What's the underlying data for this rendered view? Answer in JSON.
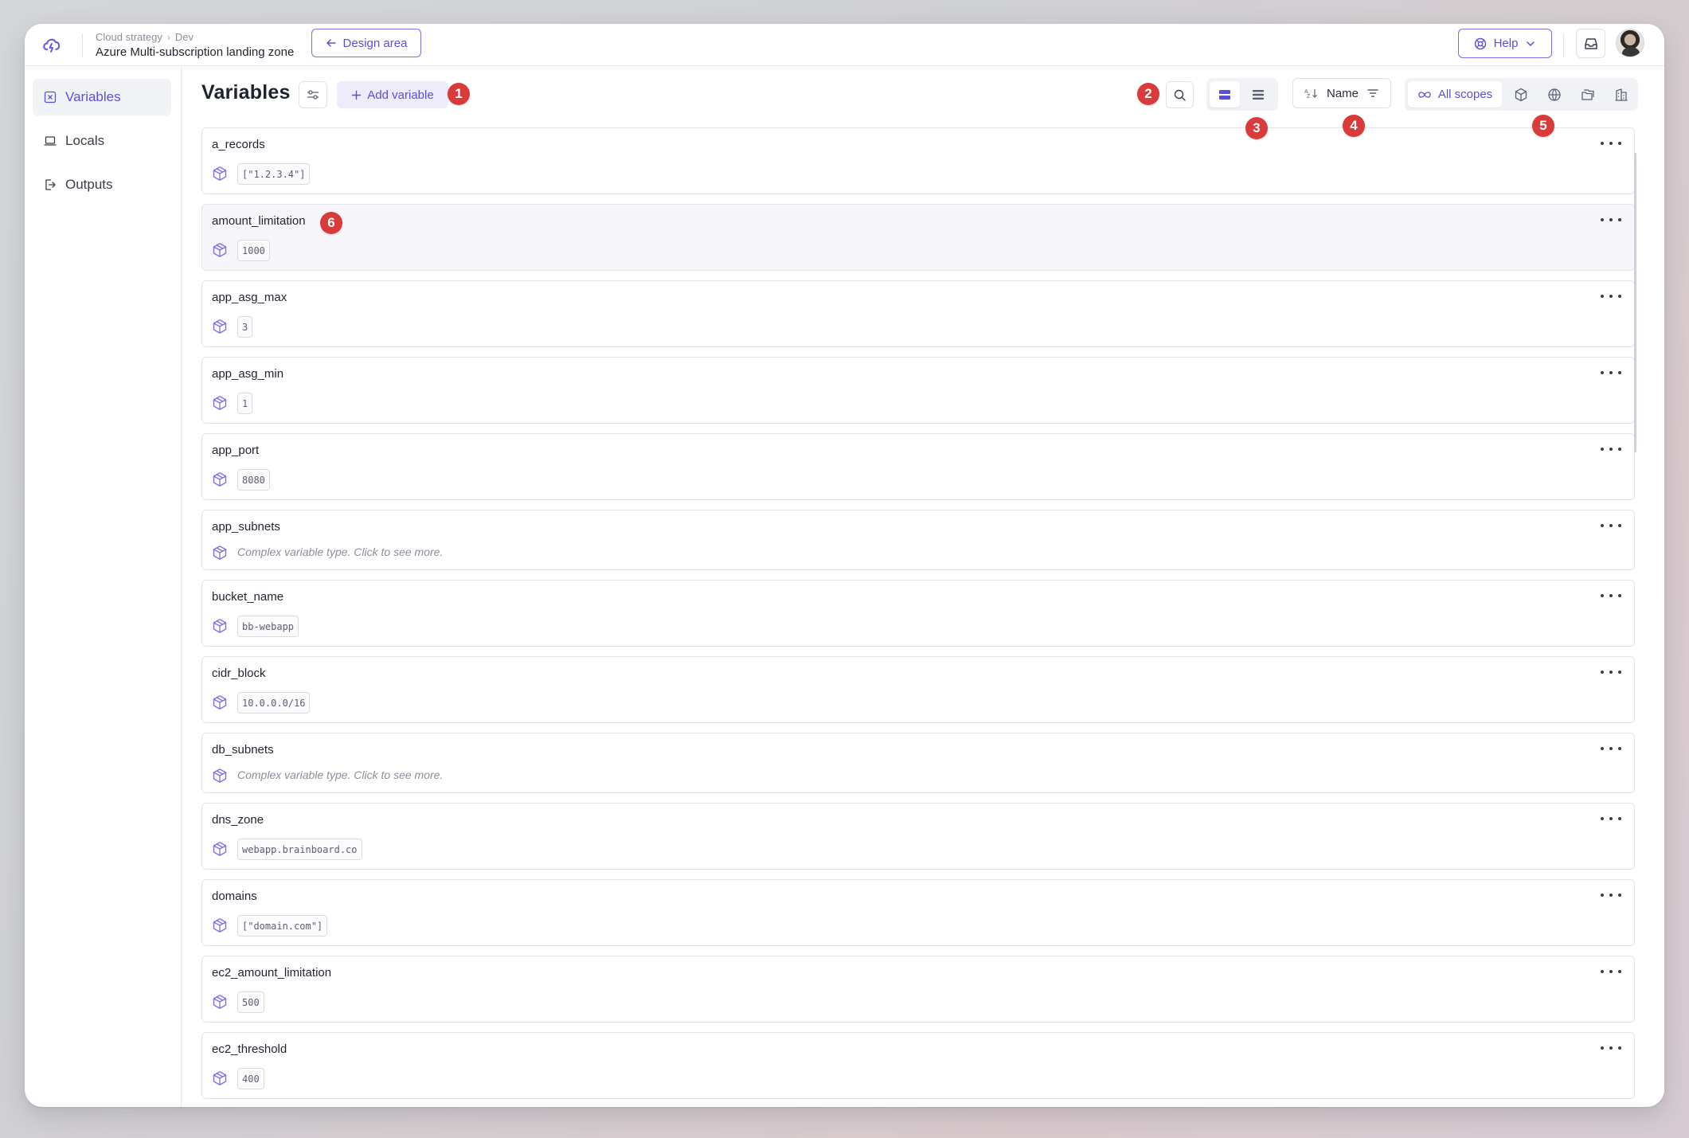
{
  "breadcrumb": {
    "parent": "Cloud strategy",
    "child": "Dev",
    "separator": "›"
  },
  "project_title": "Azure Multi-subscription landing zone",
  "design_area_label": "Design area",
  "help_label": "Help",
  "sidebar": {
    "items": [
      {
        "label": "Variables",
        "icon": "variables-icon",
        "active": true
      },
      {
        "label": "Locals",
        "icon": "laptop-icon",
        "active": false
      },
      {
        "label": "Outputs",
        "icon": "export-icon",
        "active": false
      }
    ]
  },
  "page": {
    "title": "Variables",
    "add_variable_label": "Add variable",
    "sort_label": "Name",
    "scope_all_label": "All scopes"
  },
  "markers": [
    "1",
    "2",
    "3",
    "4",
    "5",
    "6"
  ],
  "variables": [
    {
      "name": "a_records",
      "value": "[\"1.2.3.4\"]",
      "complex": false
    },
    {
      "name": "amount_limitation",
      "value": "1000",
      "complex": false
    },
    {
      "name": "app_asg_max",
      "value": "3",
      "complex": false
    },
    {
      "name": "app_asg_min",
      "value": "1",
      "complex": false
    },
    {
      "name": "app_port",
      "value": "8080",
      "complex": false
    },
    {
      "name": "app_subnets",
      "value": "Complex variable type. Click to see more.",
      "complex": true
    },
    {
      "name": "bucket_name",
      "value": "bb-webapp",
      "complex": false
    },
    {
      "name": "cidr_block",
      "value": "10.0.0.0/16",
      "complex": false
    },
    {
      "name": "db_subnets",
      "value": "Complex variable type. Click to see more.",
      "complex": true
    },
    {
      "name": "dns_zone",
      "value": "webapp.brainboard.co",
      "complex": false
    },
    {
      "name": "domains",
      "value": "[\"domain.com\"]",
      "complex": false
    },
    {
      "name": "ec2_amount_limitation",
      "value": "500",
      "complex": false
    },
    {
      "name": "ec2_threshold",
      "value": "400",
      "complex": false
    }
  ],
  "colors": {
    "accent": "#5b4fd6",
    "marker": "#d93a3a",
    "border": "#e4e5ea"
  }
}
